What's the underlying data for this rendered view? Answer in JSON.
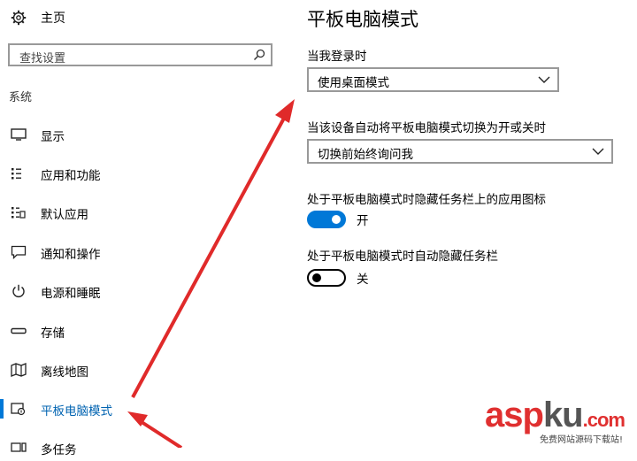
{
  "sidebar": {
    "home": {
      "label": "主页",
      "icon": "gear-icon"
    },
    "search": {
      "placeholder": "查找设置",
      "icon": "search-icon"
    },
    "section_title": "系统",
    "items": [
      {
        "label": "显示",
        "icon": "monitor-icon",
        "selected": false
      },
      {
        "label": "应用和功能",
        "icon": "apps-list-icon",
        "selected": false
      },
      {
        "label": "默认应用",
        "icon": "default-apps-icon",
        "selected": false
      },
      {
        "label": "通知和操作",
        "icon": "notification-icon",
        "selected": false
      },
      {
        "label": "电源和睡眠",
        "icon": "power-icon",
        "selected": false
      },
      {
        "label": "存储",
        "icon": "storage-icon",
        "selected": false
      },
      {
        "label": "离线地图",
        "icon": "map-icon",
        "selected": false
      },
      {
        "label": "平板电脑模式",
        "icon": "tablet-mode-icon",
        "selected": true
      },
      {
        "label": "多任务",
        "icon": "multitask-icon",
        "selected": false
      }
    ]
  },
  "main": {
    "title": "平板电脑模式",
    "signin_label": "当我登录时",
    "signin_value": "使用桌面模式",
    "auto_switch_label": "当该设备自动将平板电脑模式切换为开或关时",
    "auto_switch_value": "切换前始终询问我",
    "hide_icons_label": "处于平板电脑模式时隐藏任务栏上的应用图标",
    "hide_icons_state": "开",
    "hide_icons_on": true,
    "autohide_label": "处于平板电脑模式时自动隐藏任务栏",
    "autohide_state": "关",
    "autohide_on": false
  },
  "watermark": {
    "brand_a": "asp",
    "brand_b": "ku",
    "brand_c": ".com",
    "sub": "免费网站源码下载站!"
  },
  "colors": {
    "accent": "#0078d7",
    "arrow": "#e02a2a"
  }
}
